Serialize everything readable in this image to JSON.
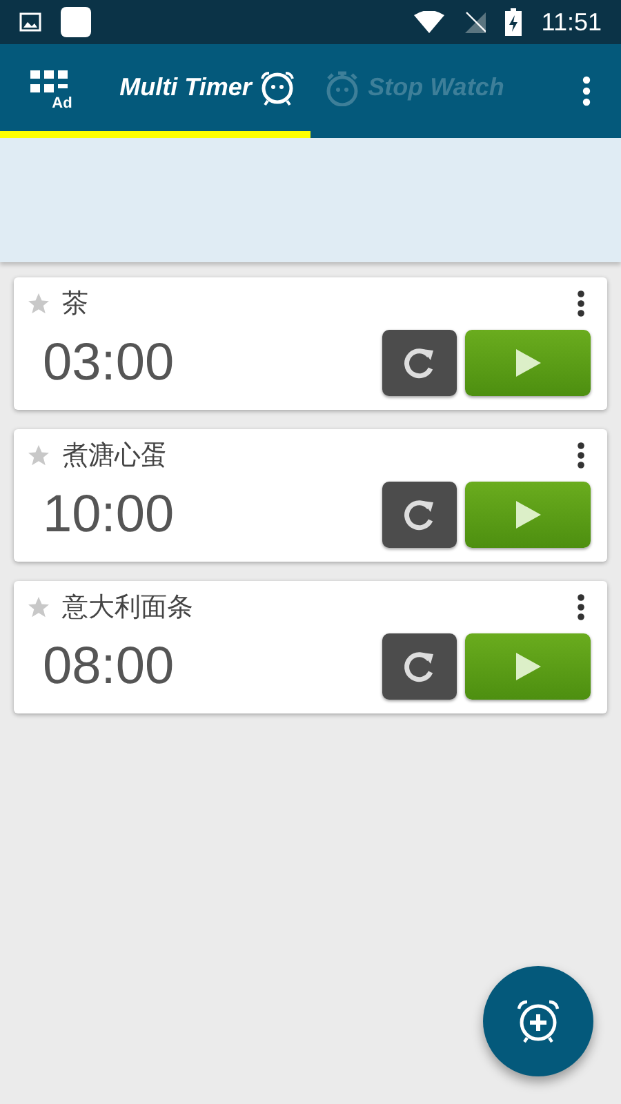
{
  "status_bar": {
    "time": "11:51"
  },
  "app_bar": {
    "ad_label": "Ad",
    "tabs": [
      {
        "label": "Multi Timer",
        "selected": true
      },
      {
        "label": "Stop Watch",
        "selected": false
      }
    ]
  },
  "timers": [
    {
      "name": "茶",
      "time": "03:00",
      "starred": false
    },
    {
      "name": "煮溏心蛋",
      "time": "10:00",
      "starred": false
    },
    {
      "name": "意大利面条",
      "time": "08:00",
      "starred": false
    }
  ]
}
